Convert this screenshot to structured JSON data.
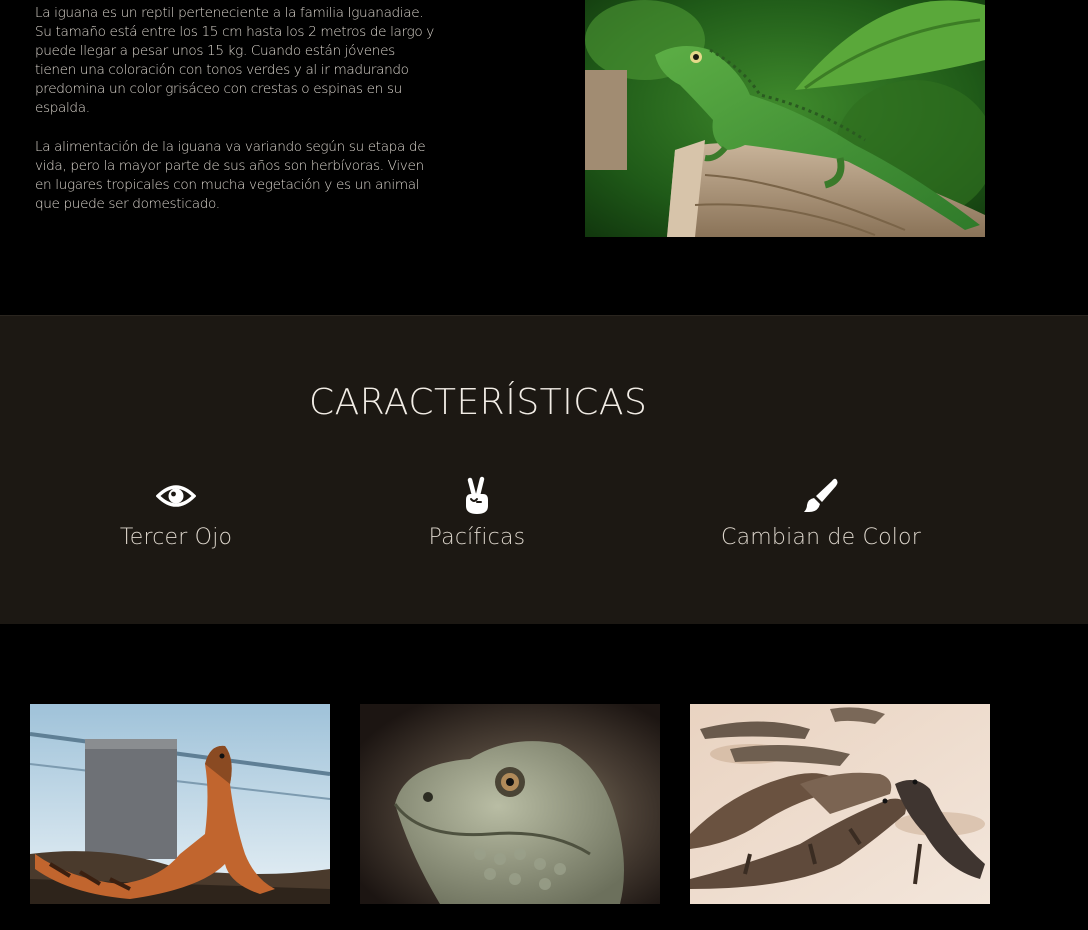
{
  "intro": {
    "paragraph_1": "La iguana es un reptil perteneciente a la familia Iguanadiae. Su tamaño está entre los 15 cm hasta los 2 metros de largo y puede llegar a pesar unos 15 kg. Cuando están jóvenes tienen una coloración con tonos verdes y al ir madurando predomina un color grisáceo con crestas o espinas en su espalda.",
    "paragraph_2": "La alimentación de la iguana va variando según su etapa de vida, pero la mayor parte de sus años son herbívoras. Viven en lugares tropicales con mucha vegetación y es un animal que puede ser domesticado.",
    "image_icon": "green-iguana-on-stump-photo"
  },
  "features": {
    "title": "CARACTERÍSTICAS",
    "items": [
      {
        "icon": "eye-icon",
        "label": "Tercer Ojo"
      },
      {
        "icon": "peace-hand-icon",
        "label": "Pacíficas"
      },
      {
        "icon": "paint-brush-icon",
        "label": "Cambian de Color"
      }
    ]
  },
  "gallery": {
    "images": [
      "orange-iguana-by-sea-photo",
      "iguana-head-closeup-photo",
      "iguanas-on-sand-photo"
    ]
  },
  "colors": {
    "page_background": "#000000",
    "features_background": "#1c1813",
    "text": "#ddd7cf"
  }
}
